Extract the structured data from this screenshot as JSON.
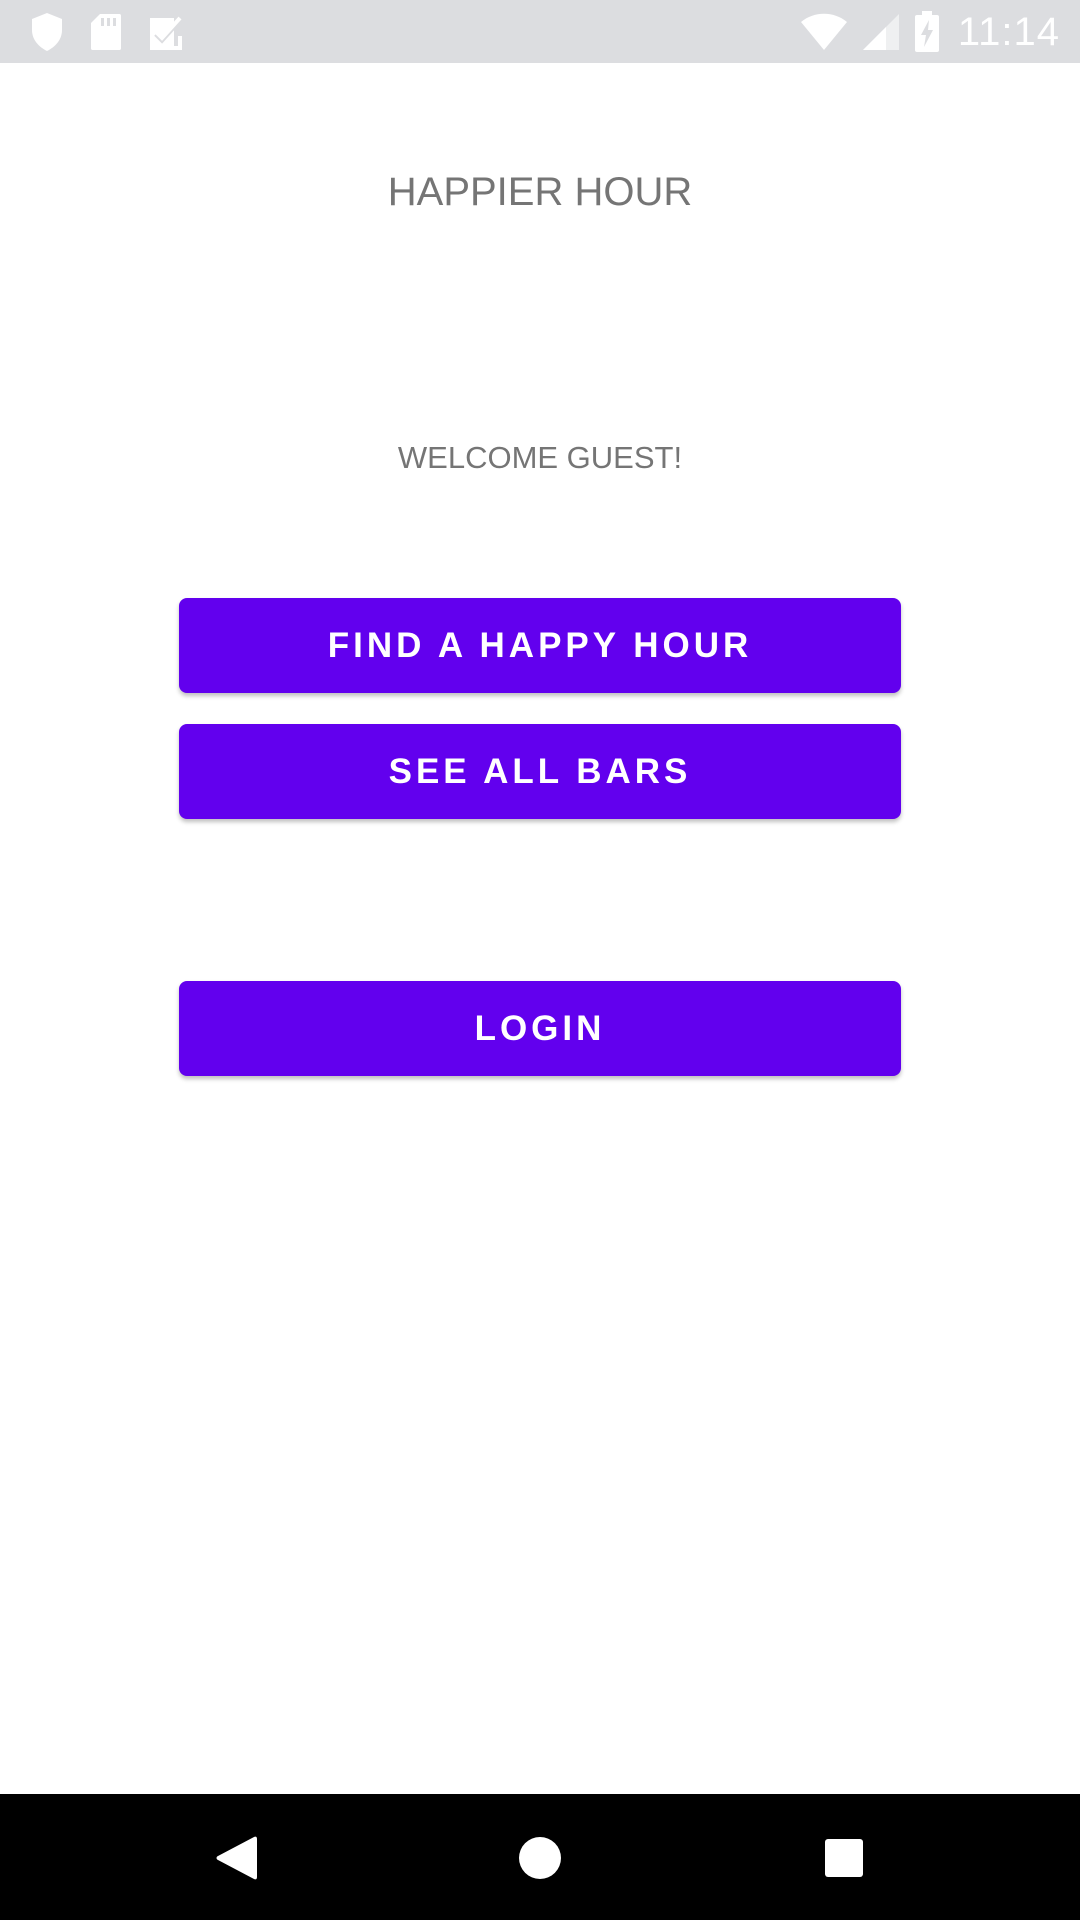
{
  "status_bar": {
    "time": "11:14",
    "left_icons": [
      "shield-icon",
      "sd-card-icon",
      "checklist-icon"
    ],
    "right_icons": [
      "wifi-icon",
      "cell-signal-icon",
      "battery-charging-icon"
    ]
  },
  "app": {
    "title": "HAPPIER HOUR",
    "welcome_text": "WELCOME GUEST!"
  },
  "buttons": {
    "find_happy_hour": "FIND A HAPPY HOUR",
    "see_all_bars": "SEE ALL BARS",
    "login": "LOGIN"
  },
  "nav_bar": {
    "icons": [
      "back-icon",
      "home-icon",
      "recents-icon"
    ]
  },
  "colors": {
    "accent": "#6200ee",
    "status_bar": "#dcdde0",
    "nav_bar": "#000000",
    "text_secondary": "#757575"
  }
}
